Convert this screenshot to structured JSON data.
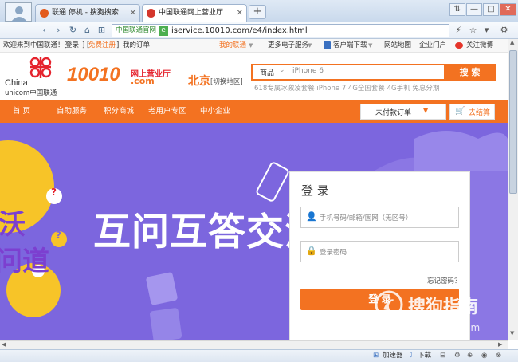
{
  "browser": {
    "tabs": [
      {
        "label": "联通 停机 - 搜狗搜索",
        "color": "#e25a1c",
        "active": false
      },
      {
        "label": "中国联通网上营业厅",
        "color": "#d4362c",
        "active": true
      }
    ],
    "new_tab": "+",
    "window_buttons": [
      "⇅",
      "—",
      "□",
      "✕"
    ],
    "nav_icons": [
      "‹",
      "›",
      "↻",
      "⌂",
      "⊞"
    ],
    "site_badge": "中国联通官网",
    "site_icon": "e",
    "url": "iservice.10010.com/e4/index.html",
    "right_icons": [
      "⚡",
      "☆",
      "▾",
      "⚙"
    ],
    "status": {
      "accelerator": "加速器",
      "download": "下载"
    }
  },
  "topbar": {
    "welcome": "欢迎来到中国联通！[",
    "login": "登录",
    "separator": "] [",
    "register": "免费注册",
    "close_bracket": "]",
    "my_orders": "我的订单",
    "my_unicom": "我的联通",
    "more_services": "更多电子服务",
    "client_download": "客户端下载",
    "sitemap": "网站地图",
    "enterprise": "企业门户",
    "weibo": "关注微博"
  },
  "header": {
    "logo_china": "China",
    "logo_unicom": "unicom中国联通",
    "logo_10010": "10010",
    "logo_subtitle": "网上营业厅",
    "logo_com": ".com",
    "city": "北京",
    "switch_region": "[切换地区]",
    "search_category": "商品",
    "search_placeholder": "iPhone 6",
    "search_button": "搜 索",
    "hot_keywords": "618专属冰激凌套餐 iPhone 7 4G全国套餐 4G手机 免息分期"
  },
  "mainnav": {
    "items": [
      "首 页",
      "自助服务",
      "积分商城",
      "老用户专区",
      "中小企业"
    ],
    "unpaid_orders": "未付款订单",
    "checkout": "去结算"
  },
  "hero": {
    "headline": "互问互答交流",
    "side_top": "沃",
    "side_bottom": "问道"
  },
  "login": {
    "title": "登 录",
    "phone_placeholder": "手机号码/邮箱/固网（无区号）",
    "password_placeholder": "登录密码",
    "forgot": "忘记密码？",
    "submit": "登 录"
  },
  "watermark": {
    "brand": "搜狗指南",
    "url": "zhinan.sogou.com"
  }
}
